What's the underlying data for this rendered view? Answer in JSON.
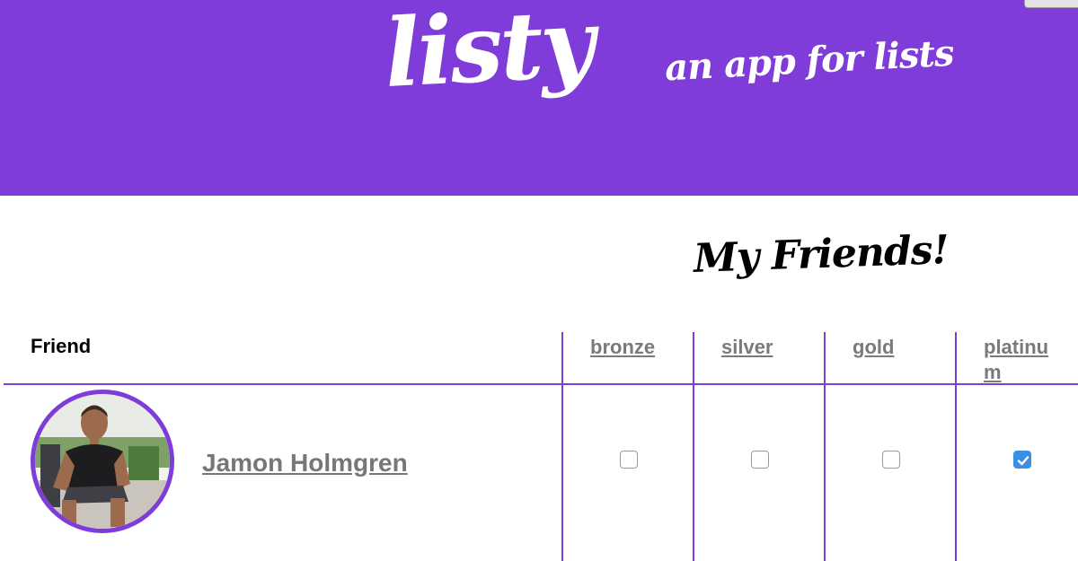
{
  "app": {
    "logo_text": "listy",
    "tagline": "an app for lists",
    "brand_color": "#7f3cd9"
  },
  "page": {
    "title": "My Friends!"
  },
  "table": {
    "friend_header": "Friend",
    "level_headers": [
      "bronze",
      "silver",
      "gold",
      "platinum"
    ],
    "rows": [
      {
        "avatar_icon": "friend-photo",
        "name": "Jamon Holmgren",
        "levels": {
          "bronze": false,
          "silver": false,
          "gold": false,
          "platinum": true
        }
      }
    ]
  },
  "colors": {
    "header_bg": "#7f3cd9",
    "checkbox_checked": "#3a8ee6",
    "link_gray": "#777777"
  }
}
